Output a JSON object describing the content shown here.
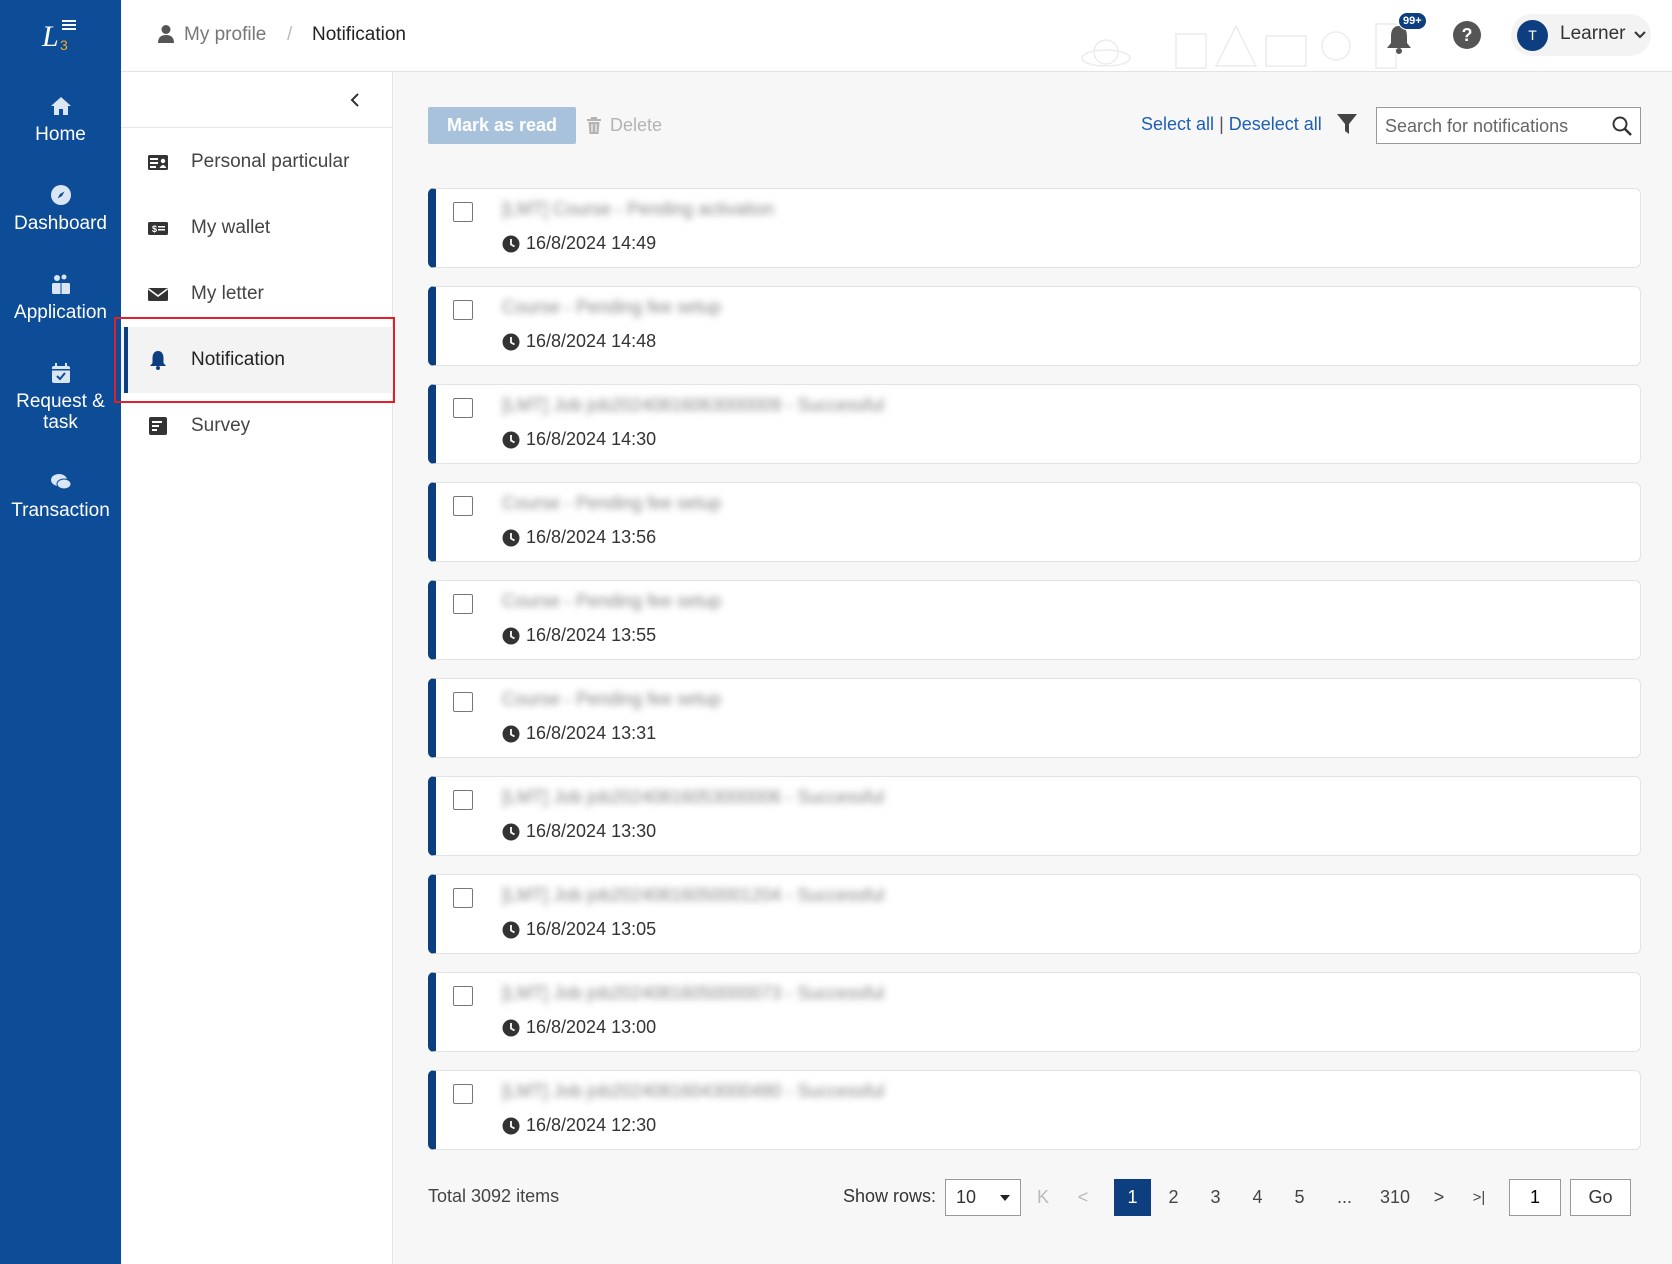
{
  "nav": {
    "items": [
      {
        "label": "Home",
        "icon": "home-icon"
      },
      {
        "label": "Dashboard",
        "icon": "compass-icon"
      },
      {
        "label": "Application",
        "icon": "application-icon"
      },
      {
        "label": "Request &",
        "label2": "task",
        "icon": "calendar-check-icon"
      },
      {
        "label": "Transaction",
        "icon": "chat-icon"
      }
    ]
  },
  "header": {
    "breadcrumb": [
      "My profile",
      "Notification"
    ],
    "separator": "/",
    "bell_badge": "99+",
    "avatar_initial": "T",
    "user_role": "Learner"
  },
  "submenu": {
    "items": [
      {
        "label": "Personal particular",
        "icon": "id-card-icon"
      },
      {
        "label": "My wallet",
        "icon": "wallet-icon"
      },
      {
        "label": "My letter",
        "icon": "envelope-icon"
      },
      {
        "label": "Notification",
        "icon": "bell-icon",
        "active": true
      },
      {
        "label": "Survey",
        "icon": "survey-icon"
      }
    ]
  },
  "toolbar": {
    "mark_label": "Mark as read",
    "delete_label": "Delete",
    "select_all": "Select all",
    "sep": "|",
    "deselect_all": "Deselect all",
    "search_placeholder": "Search for notifications"
  },
  "notifications": [
    {
      "title": "[LMT] Course - Pending activation",
      "time": "16/8/2024 14:49"
    },
    {
      "title": "Course - Pending fee setup",
      "time": "16/8/2024 14:48"
    },
    {
      "title": "[LMT] Job job20240816063000009 - Successful",
      "time": "16/8/2024 14:30"
    },
    {
      "title": "Course - Pending fee setup",
      "time": "16/8/2024 13:56"
    },
    {
      "title": "Course - Pending fee setup",
      "time": "16/8/2024 13:55"
    },
    {
      "title": "Course - Pending fee setup",
      "time": "16/8/2024 13:31"
    },
    {
      "title": "[LMT] Job job20240816053000006 - Successful",
      "time": "16/8/2024 13:30"
    },
    {
      "title": "[LMT] Job job20240816050001204 - Successful",
      "time": "16/8/2024 13:05"
    },
    {
      "title": "[LMT] Job job20240816050000073 - Successful",
      "time": "16/8/2024 13:00"
    },
    {
      "title": "[LMT] Job job20240816043000480 - Successful",
      "time": "16/8/2024 12:30"
    }
  ],
  "pagination": {
    "total": "Total 3092 items",
    "show_rows_label": "Show rows:",
    "rows_value": "10",
    "first": "K",
    "prev": "<",
    "pages": [
      "1",
      "2",
      "3",
      "4",
      "5"
    ],
    "ellipsis": "...",
    "last_page": "310",
    "next": ">",
    "last": ">|",
    "goto_value": "1",
    "go_label": "Go"
  },
  "colors": {
    "nav_bg": "#0d4c96",
    "accent": "#0d3f80",
    "link": "#1e5fb4",
    "highlight": "#e0202a"
  }
}
